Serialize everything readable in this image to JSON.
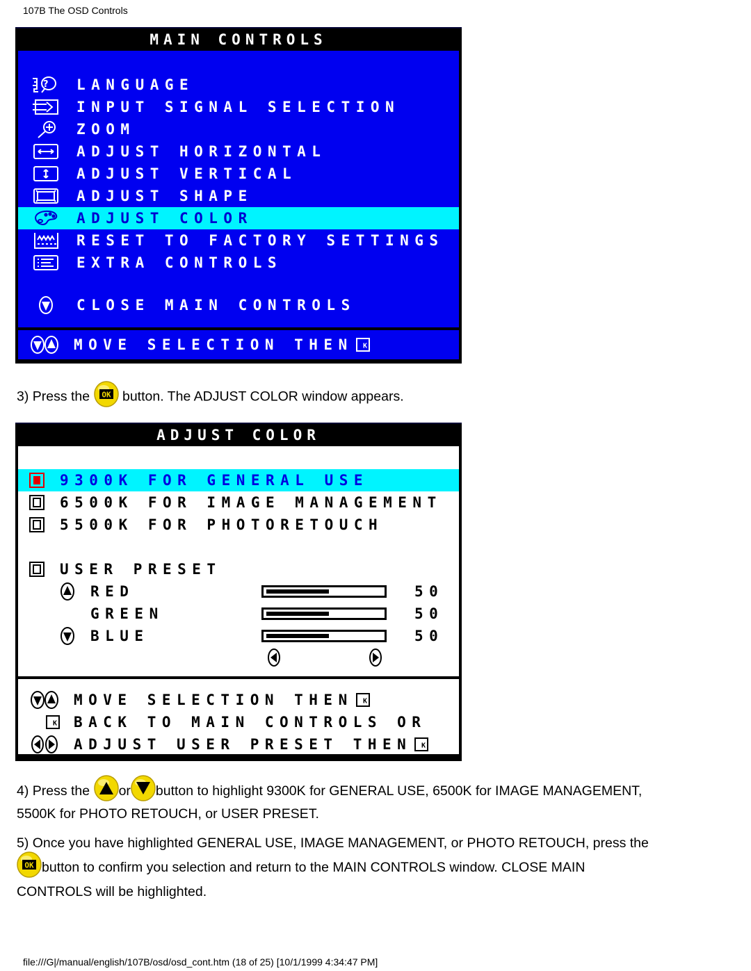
{
  "page": {
    "header": "107B The OSD Controls",
    "footer": "file:///G|/manual/english/107B/osd/osd_cont.htm (18 of 25) [10/1/1999 4:34:47 PM]"
  },
  "colors": {
    "osd_blue": "#0000f0",
    "osd_highlight": "#00f4ff",
    "osd_title_bg": "#000000",
    "osd_white_panel": "#ffffff",
    "selected_marker": "#e00000",
    "button_yellow": "#f2d800"
  },
  "main_controls": {
    "title": "MAIN CONTROLS",
    "items": [
      {
        "label": "LANGUAGE",
        "icon": "language-icon",
        "selected": false
      },
      {
        "label": "INPUT SIGNAL SELECTION",
        "icon": "input-signal-icon",
        "selected": false
      },
      {
        "label": "ZOOM",
        "icon": "zoom-icon",
        "selected": false
      },
      {
        "label": "ADJUST HORIZONTAL",
        "icon": "horizontal-arrows-icon",
        "selected": false
      },
      {
        "label": "ADJUST VERTICAL",
        "icon": "vertical-arrows-icon",
        "selected": false
      },
      {
        "label": "ADJUST SHAPE",
        "icon": "shape-icon",
        "selected": false
      },
      {
        "label": "ADJUST COLOR",
        "icon": "palette-icon",
        "selected": true
      },
      {
        "label": "RESET TO FACTORY SETTINGS",
        "icon": "factory-reset-icon",
        "selected": false
      },
      {
        "label": "EXTRA CONTROLS",
        "icon": "extra-controls-icon",
        "selected": false
      }
    ],
    "close_label": "CLOSE MAIN CONTROLS",
    "hint": "MOVE SELECTION THEN"
  },
  "step3": {
    "before": "3) Press the",
    "after": "button. The ADJUST COLOR window appears."
  },
  "adjust_color": {
    "title": "ADJUST COLOR",
    "options": [
      {
        "label": "9300K FOR GENERAL USE",
        "selected": true
      },
      {
        "label": "6500K FOR IMAGE MANAGEMENT",
        "selected": false
      },
      {
        "label": "5500K FOR PHOTORETOUCH",
        "selected": false
      }
    ],
    "user_preset": {
      "label": "USER PRESET",
      "channels": [
        {
          "label": "RED",
          "value": "50",
          "level": 0.5,
          "icon": "up-button-icon"
        },
        {
          "label": "GREEN",
          "value": "50",
          "level": 0.5,
          "icon": ""
        },
        {
          "label": "BLUE",
          "value": "50",
          "level": 0.5,
          "icon": "down-button-icon"
        }
      ]
    },
    "hints": [
      "MOVE SELECTION THEN",
      "BACK TO MAIN CONTROLS OR",
      "ADJUST USER PRESET THEN"
    ]
  },
  "step4": {
    "before": "4) Press the",
    "or": "or",
    "after": "button to highlight 9300K for GENERAL USE, 6500K for IMAGE MANAGEMENT,",
    "line2": "5500K for PHOTO RETOUCH, or USER PRESET."
  },
  "step5": {
    "line1": "5) Once you have highlighted GENERAL USE, IMAGE MANAGEMENT, or PHOTO RETOUCH, press the",
    "line2": "button to confirm you selection and return to the MAIN CONTROLS window. CLOSE MAIN",
    "line3": "CONTROLS will be highlighted."
  }
}
